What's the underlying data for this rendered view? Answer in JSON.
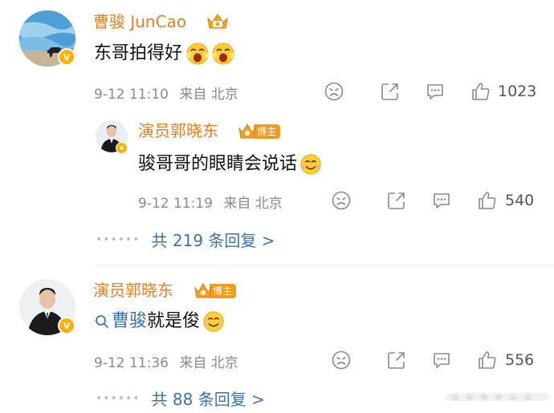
{
  "comments": [
    {
      "user_name": "曹骏 JunCao",
      "text": "东哥拍得好",
      "time": "9-12 11:10",
      "source": "来自 北京",
      "likes": "1023"
    },
    {
      "user_name": "演员郭晓东",
      "badge": "博主",
      "text": "骏哥哥的眼睛会说话",
      "time": "9-12 11:19",
      "source": "来自 北京",
      "likes": "540",
      "replies": "共 219 条回复 >"
    },
    {
      "user_name": "演员郭晓东",
      "badge": "博主",
      "mention": "曹骏",
      "text": "就是俊",
      "time": "9-12 11:36",
      "source": "来自 北京",
      "likes": "556",
      "replies": "共 88 条回复 >"
    }
  ],
  "verified_mark": "V",
  "colors": {
    "username": "#f07c1c",
    "link": "#3b72b5",
    "meta": "#8a8a8a",
    "badge": "#f29b1c",
    "verified": "#ffb000"
  },
  "icons": [
    "sad-face-icon",
    "share-icon",
    "comment-icon",
    "thumbs-up-icon",
    "crown-icon",
    "search-icon"
  ]
}
